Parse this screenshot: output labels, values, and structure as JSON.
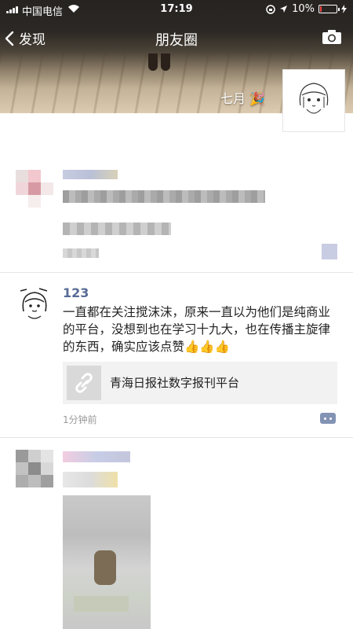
{
  "status_bar": {
    "carrier": "中国电信",
    "time": "17:19",
    "battery": "10%",
    "battery_level": 0.1
  },
  "nav": {
    "back_label": "发现",
    "title": "朋友圈"
  },
  "cover": {
    "user_name": "七月",
    "emoji_icon": "party-popper-icon"
  },
  "posts": [
    {
      "name": "",
      "text": "",
      "time": ""
    },
    {
      "name": "123",
      "text": "一直都在关注搅沫沫，原来一直以为他们是纯商业的平台，没想到也在学习十九大，也在传播主旋律的东西，确实应该点赞👍👍👍",
      "link_title": "青海日报社数字报刊平台",
      "time": "1分钟前"
    },
    {
      "name": "",
      "text": ""
    }
  ],
  "colors": {
    "name_blue": "#576b95",
    "comment_button": "#8393b4"
  }
}
